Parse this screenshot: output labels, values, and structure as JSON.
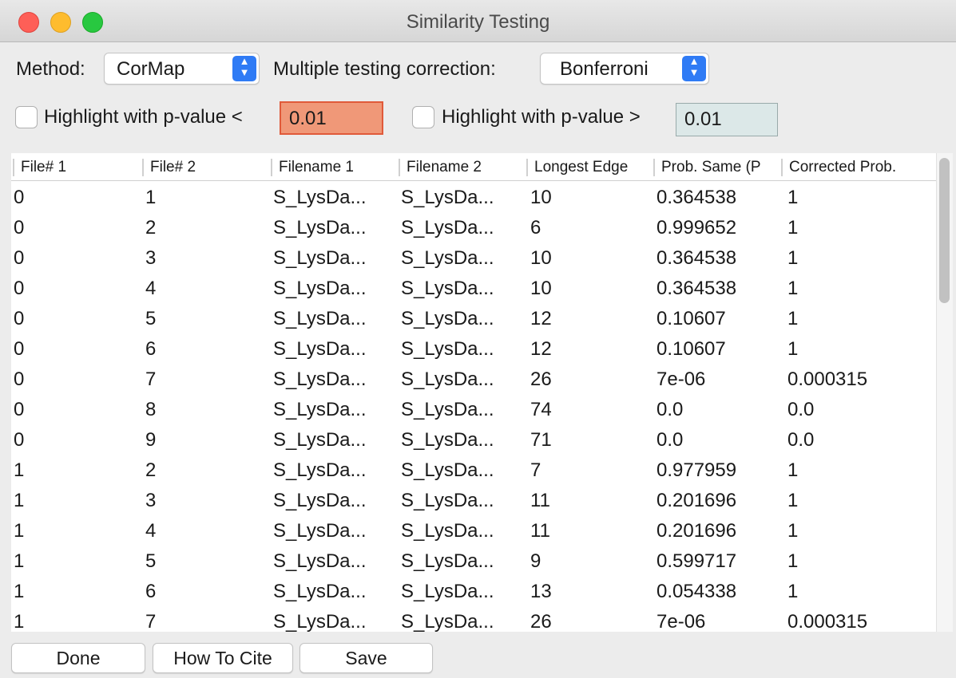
{
  "window": {
    "title": "Similarity Testing"
  },
  "controls": {
    "method_label": "Method:",
    "method_value": "CorMap",
    "correction_label": "Multiple testing correction:",
    "correction_value": "Bonferroni",
    "highlight_low_label": "Highlight with p-value <",
    "highlight_low_value": "0.01",
    "highlight_high_label": "Highlight with p-value >",
    "highlight_high_value": "0.01"
  },
  "table": {
    "columns": [
      "File# 1",
      "File# 2",
      "Filename 1",
      "Filename 2",
      "Longest Edge",
      "Prob. Same (P",
      "Corrected Prob."
    ],
    "rows": [
      [
        "0",
        "1",
        "S_LysDa...",
        "S_LysDa...",
        "10",
        "0.364538",
        "1"
      ],
      [
        "0",
        "2",
        "S_LysDa...",
        "S_LysDa...",
        "6",
        "0.999652",
        "1"
      ],
      [
        "0",
        "3",
        "S_LysDa...",
        "S_LysDa...",
        "10",
        "0.364538",
        "1"
      ],
      [
        "0",
        "4",
        "S_LysDa...",
        "S_LysDa...",
        "10",
        "0.364538",
        "1"
      ],
      [
        "0",
        "5",
        "S_LysDa...",
        "S_LysDa...",
        "12",
        "0.10607",
        "1"
      ],
      [
        "0",
        "6",
        "S_LysDa...",
        "S_LysDa...",
        "12",
        "0.10607",
        "1"
      ],
      [
        "0",
        "7",
        "S_LysDa...",
        "S_LysDa...",
        "26",
        "7e-06",
        "0.000315"
      ],
      [
        "0",
        "8",
        "S_LysDa...",
        "S_LysDa...",
        "74",
        "0.0",
        "0.0"
      ],
      [
        "0",
        "9",
        "S_LysDa...",
        "S_LysDa...",
        "71",
        "0.0",
        "0.0"
      ],
      [
        "1",
        "2",
        "S_LysDa...",
        "S_LysDa...",
        "7",
        "0.977959",
        "1"
      ],
      [
        "1",
        "3",
        "S_LysDa...",
        "S_LysDa...",
        "11",
        "0.201696",
        "1"
      ],
      [
        "1",
        "4",
        "S_LysDa...",
        "S_LysDa...",
        "11",
        "0.201696",
        "1"
      ],
      [
        "1",
        "5",
        "S_LysDa...",
        "S_LysDa...",
        "9",
        "0.599717",
        "1"
      ],
      [
        "1",
        "6",
        "S_LysDa...",
        "S_LysDa...",
        "13",
        "0.054338",
        "1"
      ],
      [
        "1",
        "7",
        "S_LysDa...",
        "S_LysDa...",
        "26",
        "7e-06",
        "0.000315"
      ]
    ]
  },
  "buttons": {
    "done": "Done",
    "cite": "How To Cite",
    "save": "Save"
  },
  "colors": {
    "low_field": "#f09878",
    "high_field": "#dce8e8",
    "accent": "#2f7bf5"
  }
}
